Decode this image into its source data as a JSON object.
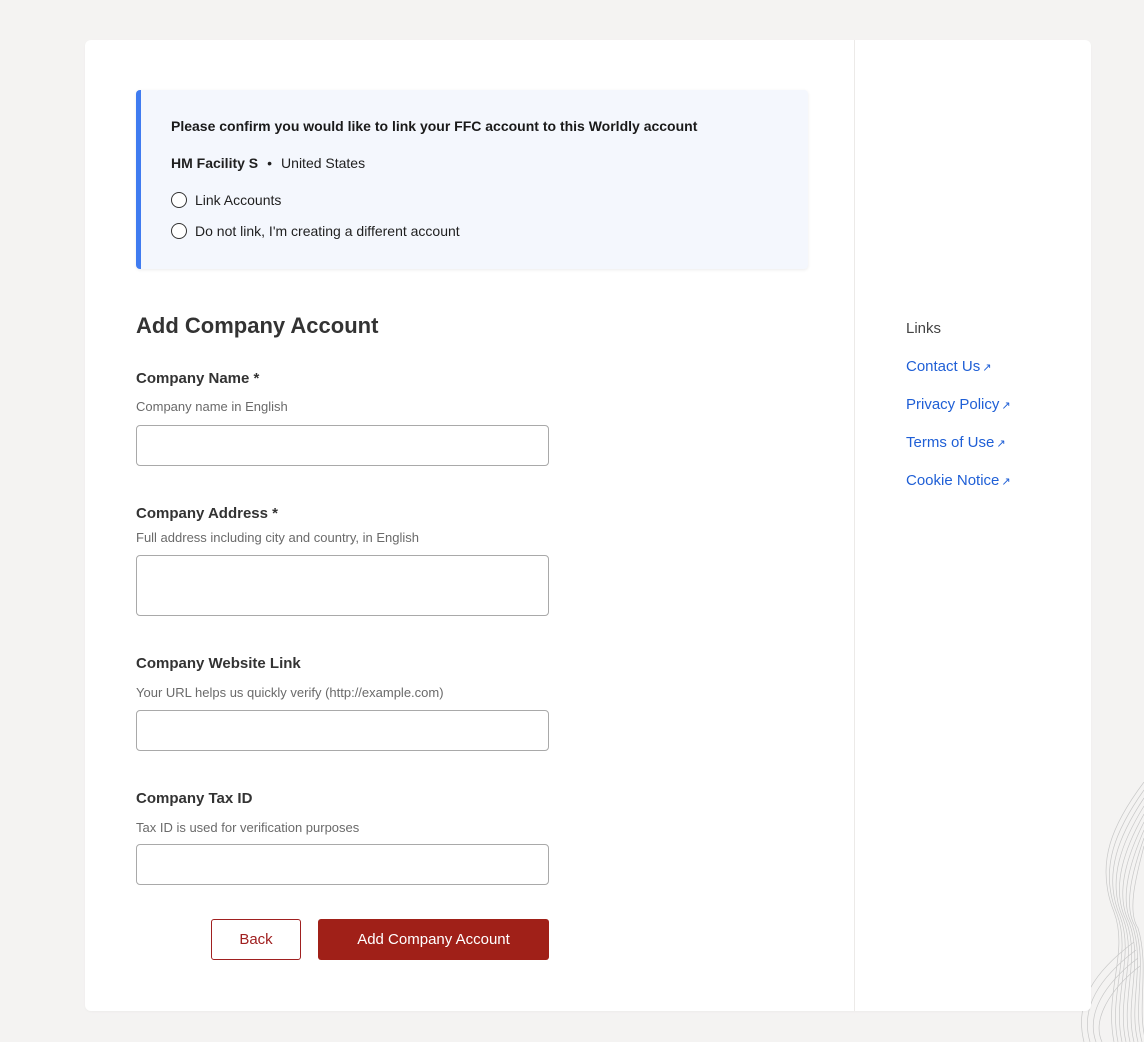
{
  "confirm": {
    "title": "Please confirm you would like to link your FFC account to this Worldly account",
    "facility_name": "HM Facility S",
    "separator": "•",
    "country": "United States",
    "options": [
      {
        "label": "Link Accounts",
        "selected": false
      },
      {
        "label": "Do not link, I'm creating a different account",
        "selected": false
      }
    ]
  },
  "form": {
    "title": "Add Company Account",
    "fields": [
      {
        "label": "Company Name *",
        "help": "Company name in English",
        "value": ""
      },
      {
        "label": "Company Address *",
        "help": "Full address including city and country, in English",
        "value": ""
      },
      {
        "label": "Company Website Link",
        "help": "Your URL helps us quickly verify (http://example.com)",
        "value": ""
      },
      {
        "label": "Company Tax ID",
        "help": "Tax ID is used for verification purposes",
        "value": ""
      }
    ],
    "back_label": "Back",
    "submit_label": "Add Company Account"
  },
  "sidebar": {
    "title": "Links",
    "links": [
      {
        "label": "Contact Us",
        "icon": "external-link-icon"
      },
      {
        "label": "Privacy Policy",
        "icon": "external-link-icon"
      },
      {
        "label": "Terms of Use",
        "icon": "external-link-icon"
      },
      {
        "label": "Cookie Notice",
        "icon": "external-link-icon"
      }
    ],
    "link_icon_glyph": "↗"
  },
  "colors": {
    "accent_blue": "#3f7bf0",
    "link_blue": "#1f5fd6",
    "primary_red": "#a02018",
    "background": "#f4f3f2"
  }
}
